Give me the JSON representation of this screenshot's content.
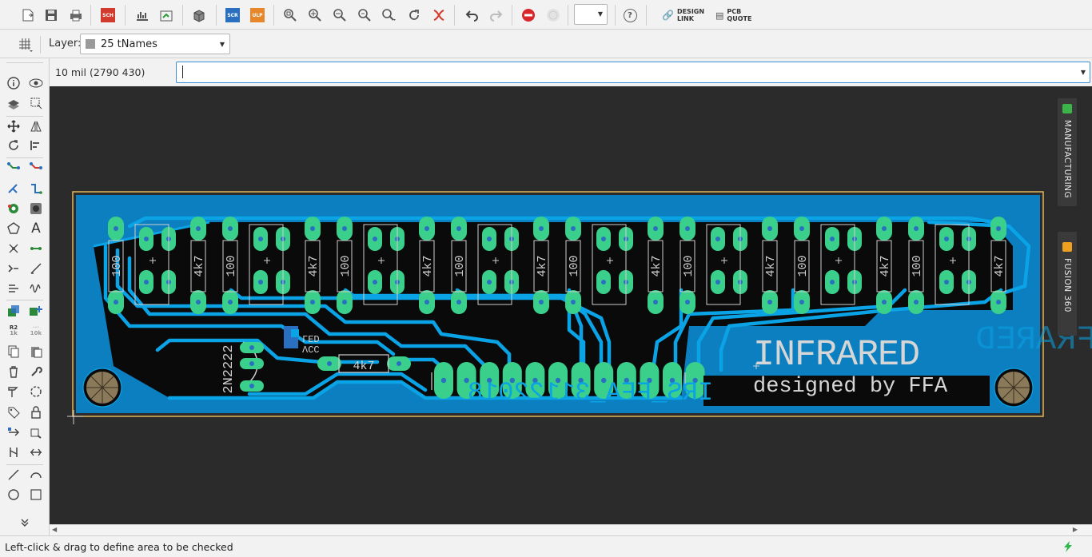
{
  "toolbar": {
    "icons": [
      "open-icon",
      "save-icon",
      "print-icon",
      "schematic-icon",
      "cam-icon",
      "manufacturing-icon",
      "3d-icon",
      "script-icon",
      "ulp-icon",
      "zoom-fit-icon",
      "zoom-in-icon",
      "zoom-out-icon",
      "zoom-select-icon",
      "zoom-area-icon",
      "redraw-icon",
      "ratsnest-icon",
      "undo-icon",
      "redo-icon",
      "stop-icon",
      "go-icon",
      "help-icon"
    ],
    "schematic_badge": "SCH",
    "script_badge": "SCR",
    "ulp_badge": "ULP",
    "zoom_value": "",
    "help_label": "?",
    "design_link_line1": "DESIGN",
    "design_link_line2": "LINK",
    "pcb_quote_line1": "PCB",
    "pcb_quote_line2": "QUOTE"
  },
  "layerbar": {
    "label": "Layer:",
    "selected_layer": "25 tNames",
    "layer_color": "#9a9a9a"
  },
  "command": {
    "coords": "10 mil (2790 430)",
    "value": "",
    "placeholder": ""
  },
  "palette": {
    "r2_label": "R2",
    "r2_value": "1k",
    "tenk_label": "10k"
  },
  "board": {
    "colors": {
      "board_fill": "#0b7fc0",
      "copper": "#0aa3e6",
      "pad": "#3bcf8c",
      "outline": "#f0c060",
      "silk": "#cfcfcf",
      "canvas": "#2b2b2b"
    },
    "resistor_labels": [
      "100",
      "4k7",
      "100",
      "4k7",
      "100",
      "4k7",
      "100",
      "4k7",
      "100",
      "4k7",
      "100",
      "4k7",
      "100",
      "4k7",
      "100",
      "4k7"
    ],
    "transistor_label": "2N2222",
    "led_label": "LED",
    "led_vcc_label": "VCC",
    "bottom_resistor_label": "4k7",
    "title_text": "INFRARED",
    "mirrored_title": "INFRARED",
    "subtitle_text": "designed by FFA",
    "mirrored_code": "IRS_FFA_31122018"
  },
  "side_tabs": {
    "manufacturing": "MANUFACTURING",
    "fusion": "FUSION 360"
  },
  "status": {
    "message": "Left-click & drag to define area to be checked",
    "bolt_color": "#2db84a"
  }
}
